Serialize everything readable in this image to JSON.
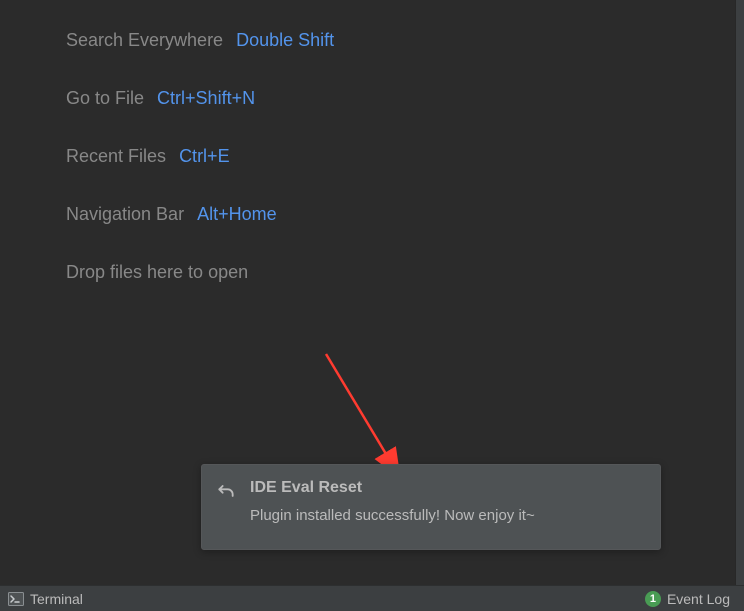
{
  "hints": {
    "search_label": "Search Everywhere",
    "search_key": "Double Shift",
    "file_label": "Go to File",
    "file_key": "Ctrl+Shift+N",
    "recent_label": "Recent Files",
    "recent_key": "Ctrl+E",
    "nav_label": "Navigation Bar",
    "nav_key": "Alt+Home",
    "drop_label": "Drop files here to open"
  },
  "notification": {
    "title": "IDE Eval Reset",
    "body": "Plugin installed successfully! Now enjoy it~"
  },
  "statusbar": {
    "terminal_label": "Terminal",
    "event_badge": "1",
    "event_label": "Event Log"
  }
}
